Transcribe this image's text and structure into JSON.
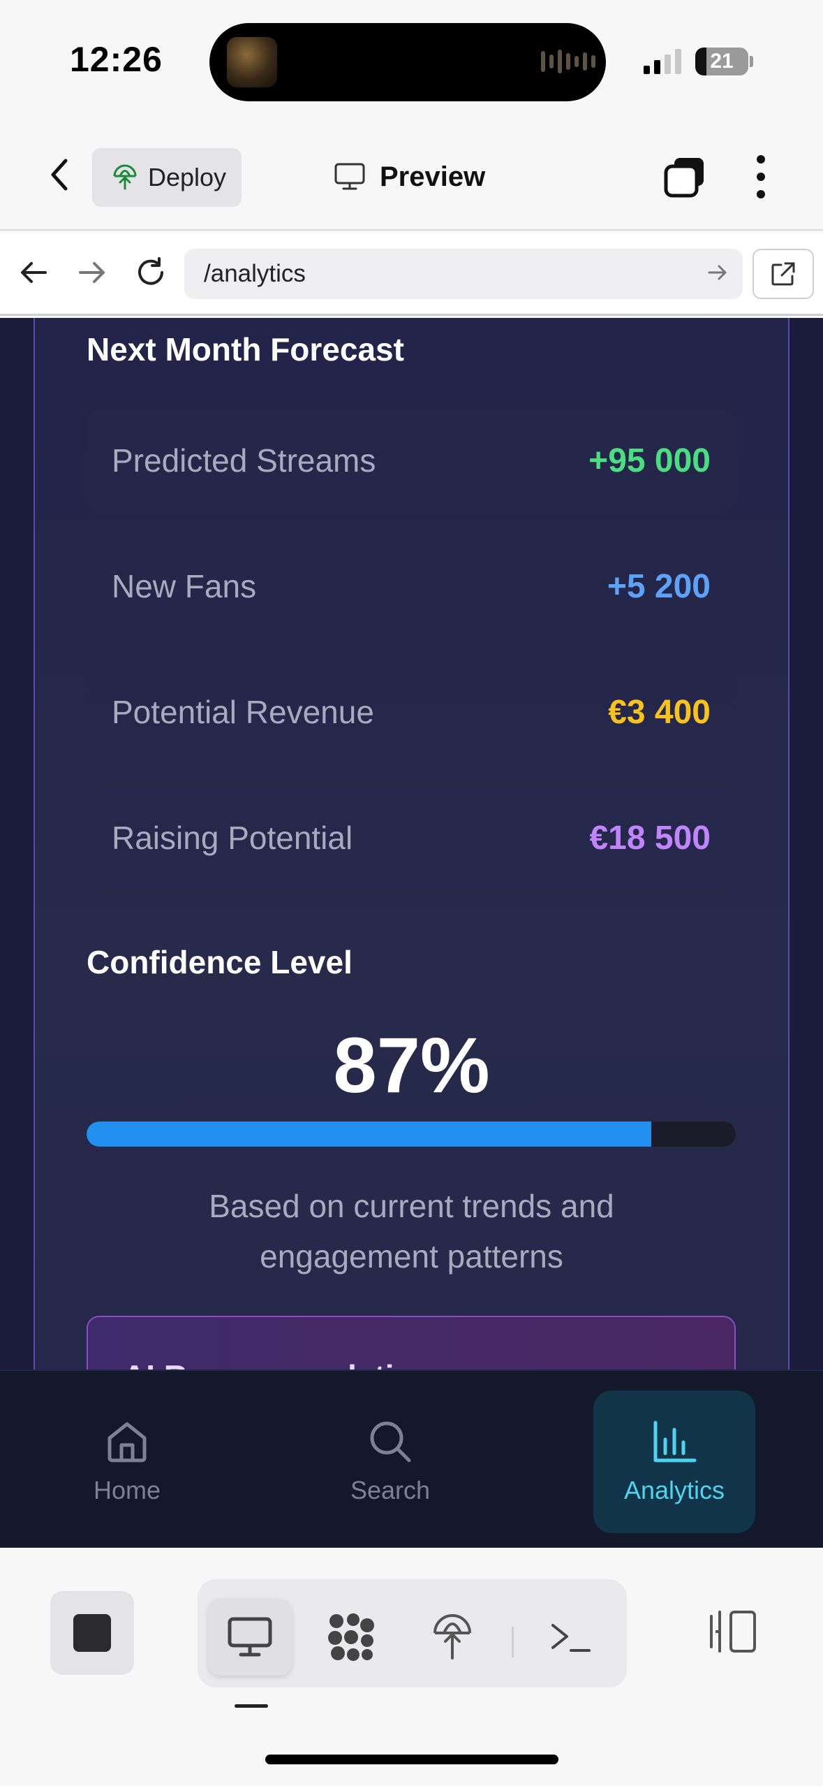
{
  "status_bar": {
    "time": "12:26",
    "battery": "21",
    "battery_fraction": 0.21
  },
  "header": {
    "deploy_label": "Deploy",
    "preview_label": "Preview"
  },
  "browser": {
    "url": "/analytics"
  },
  "forecast": {
    "title": "Next Month Forecast",
    "items": [
      {
        "label": "Predicted Streams",
        "value": "+95 000",
        "color": "#4ade80"
      },
      {
        "label": "New Fans",
        "value": "+5 200",
        "color": "#5ea2f8"
      },
      {
        "label": "Potential Revenue",
        "value": "€3 400",
        "color": "#f9c31c"
      },
      {
        "label": "Raising Potential",
        "value": "€18 500",
        "color": "#c084fc"
      }
    ]
  },
  "confidence": {
    "title": "Confidence Level",
    "value": "87%",
    "fraction": 0.87,
    "note": "Based on current trends and engagement patterns"
  },
  "ai_card": {
    "title": "AI Recommendations"
  },
  "bottom_nav": {
    "items": [
      {
        "label": "Home",
        "icon": "home-icon",
        "active": false
      },
      {
        "label": "Search",
        "icon": "search-icon",
        "active": false
      },
      {
        "label": "Analytics",
        "icon": "analytics-icon",
        "active": true
      }
    ]
  },
  "toolbar": {
    "icons": [
      "stop-icon",
      "desktop-icon",
      "shapes-icon",
      "deploy-icon",
      "terminal-icon",
      "panel-toggle-icon"
    ]
  },
  "colors": {
    "accent_blue": "#2290ef",
    "analytics_active": "#4fd3ee",
    "card_border": "#5b4bb0"
  }
}
